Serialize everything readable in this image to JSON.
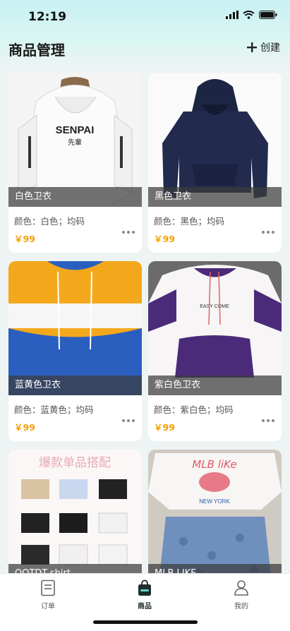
{
  "status_bar": {
    "time": "12:19"
  },
  "header": {
    "title": "商品管理",
    "create_label": "创建"
  },
  "products": [
    {
      "name": "白色卫衣",
      "spec": "颜色：白色；均码",
      "price": "￥99"
    },
    {
      "name": "黑色卫衣",
      "spec": "颜色：黑色；均码",
      "price": "￥99"
    },
    {
      "name": "蓝黄色卫衣",
      "spec": "颜色：蓝黄色；均码",
      "price": "￥99"
    },
    {
      "name": "紫白色卫衣",
      "spec": "颜色：紫白色；均码",
      "price": "￥99"
    },
    {
      "name": "OOTDT-shirt",
      "spec": "",
      "price": ""
    },
    {
      "name": "MLB LIKE",
      "spec": "",
      "price": ""
    }
  ],
  "image_text": {
    "white_hoodie_brand": "SENPAI",
    "white_hoodie_sub": "先輩",
    "purple_hoodie_text": "EASY COME",
    "tshirt_banner": "爆款单品搭配",
    "mlb_logo": "MLB liKe",
    "mlb_line": "NEW YORK"
  },
  "tabbar": {
    "tabs": [
      {
        "label": "订单",
        "icon": "order-icon",
        "active": false
      },
      {
        "label": "商品",
        "icon": "shopping-bag-icon",
        "active": true
      },
      {
        "label": "我的",
        "icon": "profile-icon",
        "active": false
      }
    ]
  },
  "colors": {
    "accent": "#f2a000",
    "header_bg": "#c9f0f2",
    "active_tab": "#1e2d2b"
  }
}
